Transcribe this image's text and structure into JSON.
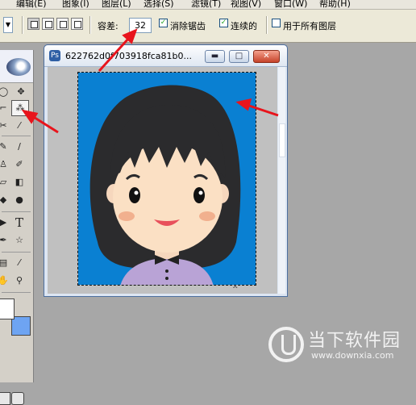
{
  "menubar": {
    "items": [
      "编辑(E)",
      "图象(I)",
      "图层(L)",
      "选择(S)",
      "滤镜(T)",
      "视图(V)",
      "窗口(W)",
      "帮助(H)"
    ]
  },
  "options": {
    "tolerance_label": "容差:",
    "tolerance_value": "32",
    "anti_alias_label": "消除锯齿",
    "anti_alias_checked": true,
    "contiguous_label": "连续的",
    "contiguous_checked": true,
    "all_layers_label": "用于所有图层",
    "all_layers_checked": false,
    "check_mark": "✓"
  },
  "document": {
    "title": "622762d0f703918fca81b0..."
  },
  "toolbox": {
    "active_tool": "magic-wand",
    "tools": [
      "lasso",
      "magic-wand",
      "crop",
      "slice",
      "healing-brush",
      "brush",
      "clone-stamp",
      "history-brush",
      "eraser",
      "gradient",
      "blur",
      "dodge",
      "path-select",
      "type",
      "pen",
      "shape",
      "notes",
      "eyedropper",
      "hand",
      "zoom"
    ],
    "foreground_color": "#ffffff",
    "background_color": "#6ea4f2"
  },
  "canvas": {
    "background_color": "#0a80d2"
  },
  "watermark": {
    "name": "当下软件园",
    "url": "www.downxia.com"
  },
  "annotations": {
    "arrow_color": "#e8141c"
  }
}
